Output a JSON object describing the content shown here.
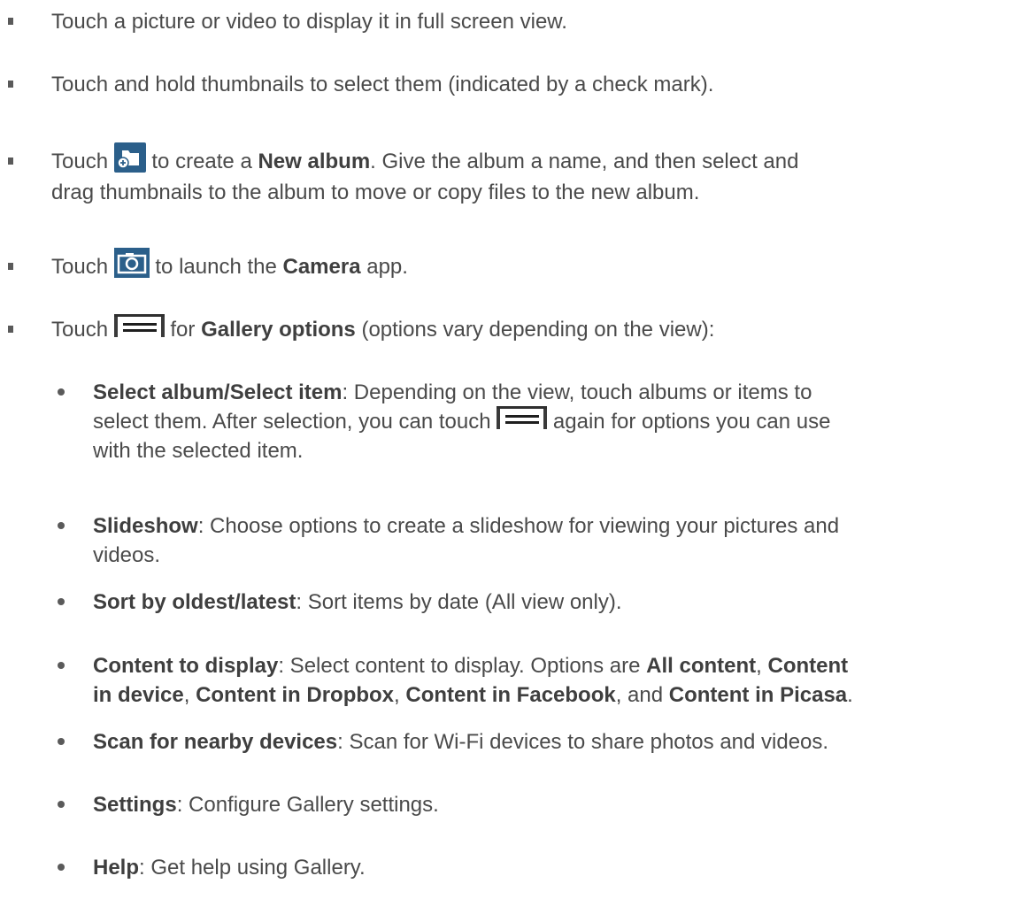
{
  "items": [
    {
      "text": "Touch a picture or video to display it in full screen view."
    },
    {
      "text": "Touch and hold thumbnails to select them (indicated by a check mark)."
    },
    {
      "pre": "Touch",
      "icon": "new-album-icon",
      "mid": "to create a",
      "bold": "New album",
      "post": ". Give the album a name, and then select and",
      "line2": "drag thumbnails to the album to move or copy files to the new album."
    },
    {
      "pre": "Touch",
      "icon": "camera-icon",
      "mid": "to launch the",
      "bold": "Camera",
      "post": "app."
    },
    {
      "pre": "Touch",
      "icon": "menu-icon",
      "mid": "for",
      "bold": "Gallery options",
      "post": "(options vary depending on the view):"
    }
  ],
  "options": [
    {
      "label": "Select album/Select item",
      "line1": ": Depending on the view, touch albums or items to",
      "line2_pre": "select them. After selection, you can touch",
      "icon": "menu-icon",
      "line2_post": "again for options you can use",
      "line3": "with the selected item."
    },
    {
      "label": "Slideshow",
      "line1": ": Choose options to create a slideshow for viewing your pictures and",
      "line2": "videos."
    },
    {
      "label": "Sort by oldest/latest",
      "line1": ": Sort items by date (All view only)."
    },
    {
      "label": "Content to display",
      "line1": ": Select content to display. Options are",
      "opt1": "All content",
      "sep1": ",",
      "opt2a": "Content",
      "opt2b": "in device",
      "sep2": ",",
      "opt3": "Content in Dropbox",
      "sep3": ",",
      "opt4": "Content in Facebook",
      "sep4": ", and",
      "opt5": "Content in Picasa",
      "end": "."
    },
    {
      "label": "Scan for nearby devices",
      "line1": ": Scan for Wi-Fi devices to share photos and videos."
    },
    {
      "label": "Settings",
      "line1": ": Configure Gallery settings."
    },
    {
      "label": "Help",
      "line1": ": Get help using Gallery."
    }
  ],
  "colors": {
    "icon_blue": "#2b5f8a",
    "text": "#4a4a4a",
    "bullet": "#5a5a5a"
  }
}
